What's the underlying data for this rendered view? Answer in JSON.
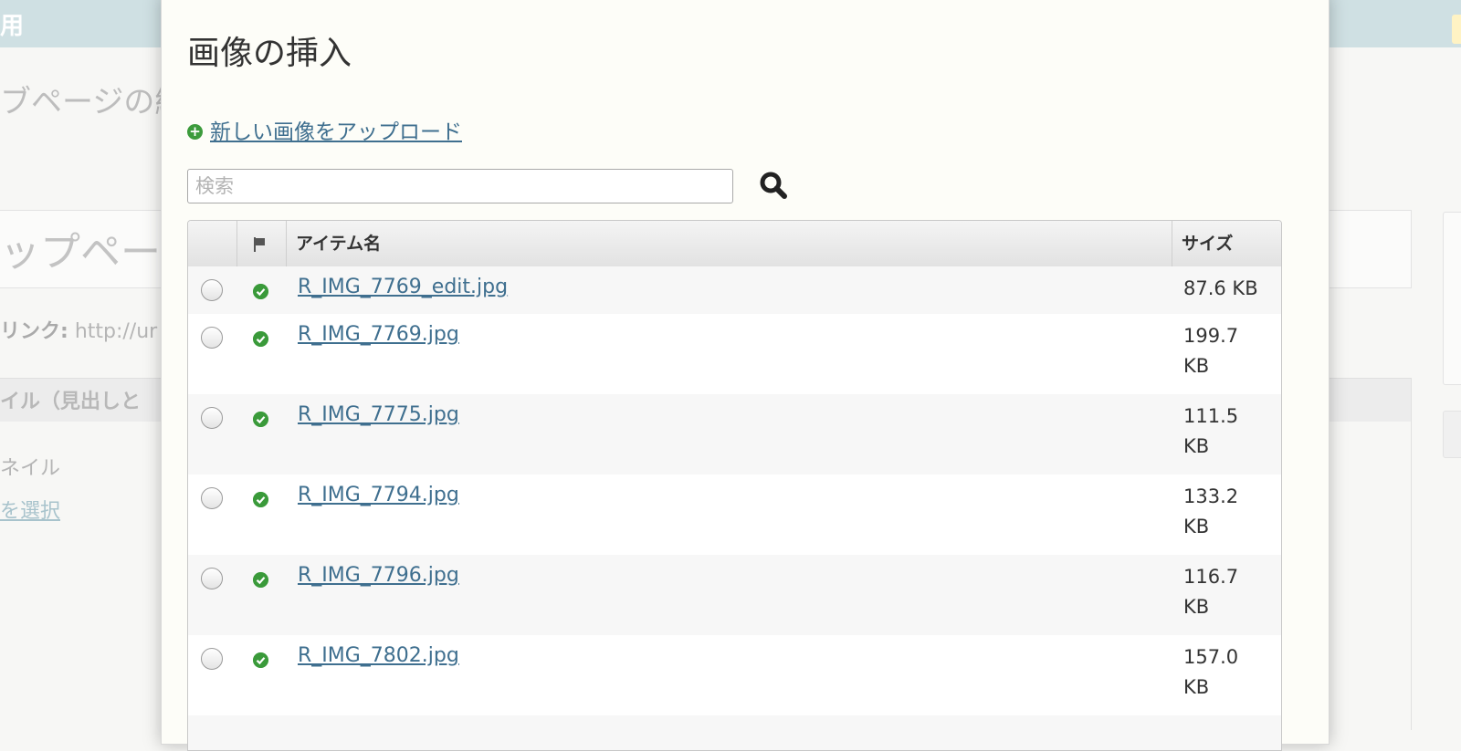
{
  "background": {
    "header_title": "用",
    "page_heading": "ブページの編",
    "panel_title": "ップページ",
    "link_label": "リンク:",
    "link_value": "http://ur",
    "section_title": "イル（見出しと",
    "thumbnail_label": "ネイル",
    "select_link": "を選択"
  },
  "modal": {
    "title": "画像の挿入",
    "upload_link": "新しい画像をアップロード",
    "search": {
      "placeholder": "検索",
      "value": ""
    },
    "table": {
      "headers": {
        "name": "アイテム名",
        "size": "サイズ"
      },
      "rows": [
        {
          "name": "R_IMG_7769_edit.jpg",
          "size_line1": "87.6 KB",
          "size_line2": ""
        },
        {
          "name": "R_IMG_7769.jpg",
          "size_line1": "199.7",
          "size_line2": "KB"
        },
        {
          "name": "R_IMG_7775.jpg",
          "size_line1": "111.5",
          "size_line2": "KB"
        },
        {
          "name": "R_IMG_7794.jpg",
          "size_line1": "133.2",
          "size_line2": "KB"
        },
        {
          "name": "R_IMG_7796.jpg",
          "size_line1": "116.7",
          "size_line2": "KB"
        },
        {
          "name": "R_IMG_7802.jpg",
          "size_line1": "157.0",
          "size_line2": "KB"
        }
      ]
    }
  },
  "colors": {
    "link": "#3f6f8f",
    "status_ok": "#3a9a3a",
    "header_bg": "#cfe0e3"
  },
  "icons": {
    "upload": "plus-circle-icon",
    "search": "magnifier-icon",
    "flag": "flag-icon",
    "status": "check-circle-icon"
  }
}
